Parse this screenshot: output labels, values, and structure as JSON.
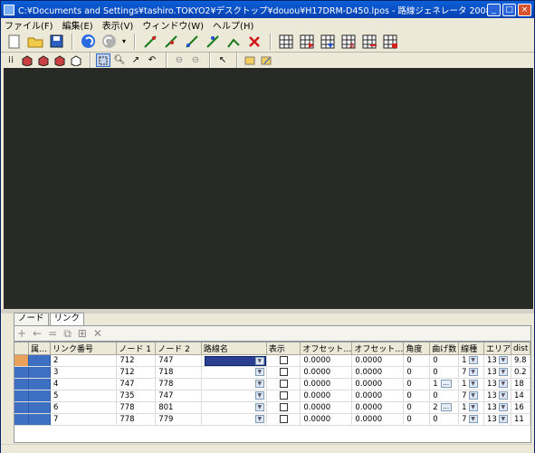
{
  "window": {
    "title": "C:¥Documents and Settings¥tashiro.TOKYO2¥デスクトップ¥douou¥H17DRM-D450.lpos - 路線ジェネレータ 2008",
    "buttons": [
      "minimize",
      "maximize",
      "close"
    ]
  },
  "menu": [
    "ファイル(F)",
    "編集(E)",
    "表示(V)",
    "ウィンドウ(W)",
    "ヘルプ(H)"
  ],
  "toolbar1": {
    "groups": [
      [
        "new-icon",
        "open-icon",
        "save-icon"
      ],
      [
        "undo-icon",
        "redo-icon",
        "dropdown-icon"
      ],
      [
        "pencil-link-icon",
        "pencil-node-icon",
        "pencil-add-icon",
        "pencil-move-icon",
        "pencil-split-icon",
        "delete-x-icon"
      ],
      [
        "grid-icon",
        "grid-arrow-icon",
        "grid-down-icon",
        "grid-a-icon",
        "grid-swap-icon",
        "grid-red-icon"
      ]
    ]
  },
  "toolbar2": {
    "icons": [
      "grid-dots-icon",
      "cube-icon",
      "cube-icon",
      "cube-icon",
      "cube-icon",
      "select-rect-icon",
      "zoom-in-icon",
      "rotate-icon",
      "pan-icon",
      "circle-left-icon",
      "circle-right-icon",
      "pointer-icon",
      "layer-icon",
      "layer-edit-icon"
    ]
  },
  "map": {
    "background": "#272a25",
    "node_color": "#8fd6a8",
    "link_colors": [
      "#b8b8e8",
      "#e8e070",
      "#8ab870",
      "#d06060",
      "#7050d0"
    ]
  },
  "tabs": [
    "ノード",
    "リンク"
  ],
  "grid_toolbar": [
    "+",
    "←",
    "=",
    "⧉",
    "⊞",
    "✕"
  ],
  "table": {
    "columns": [
      "",
      "属…",
      "リンク番号",
      "ノード 1",
      "ノード 2",
      "路線名",
      "表示",
      "オフセット…",
      "オフセット…",
      "角度",
      "曲げ数",
      "線種",
      "エリア",
      "dist"
    ],
    "rows": [
      [
        "2",
        "712",
        "747",
        "",
        "",
        "0.0000",
        "0.0000",
        "0",
        "0",
        "1",
        "13",
        "9.8"
      ],
      [
        "3",
        "712",
        "718",
        "",
        "",
        "0.0000",
        "0.0000",
        "0",
        "0",
        "7",
        "13",
        "0.2"
      ],
      [
        "4",
        "747",
        "778",
        "",
        "",
        "0.0000",
        "0.0000",
        "0",
        "1",
        "1",
        "13",
        "18"
      ],
      [
        "5",
        "735",
        "747",
        "",
        "",
        "0.0000",
        "0.0000",
        "0",
        "0",
        "7",
        "13",
        "14"
      ],
      [
        "6",
        "778",
        "801",
        "",
        "",
        "0.0000",
        "0.0000",
        "0",
        "2",
        "1",
        "13",
        "16"
      ],
      [
        "7",
        "778",
        "779",
        "",
        "",
        "0.0000",
        "0.0000",
        "0",
        "0",
        "7",
        "13",
        "11"
      ]
    ]
  }
}
